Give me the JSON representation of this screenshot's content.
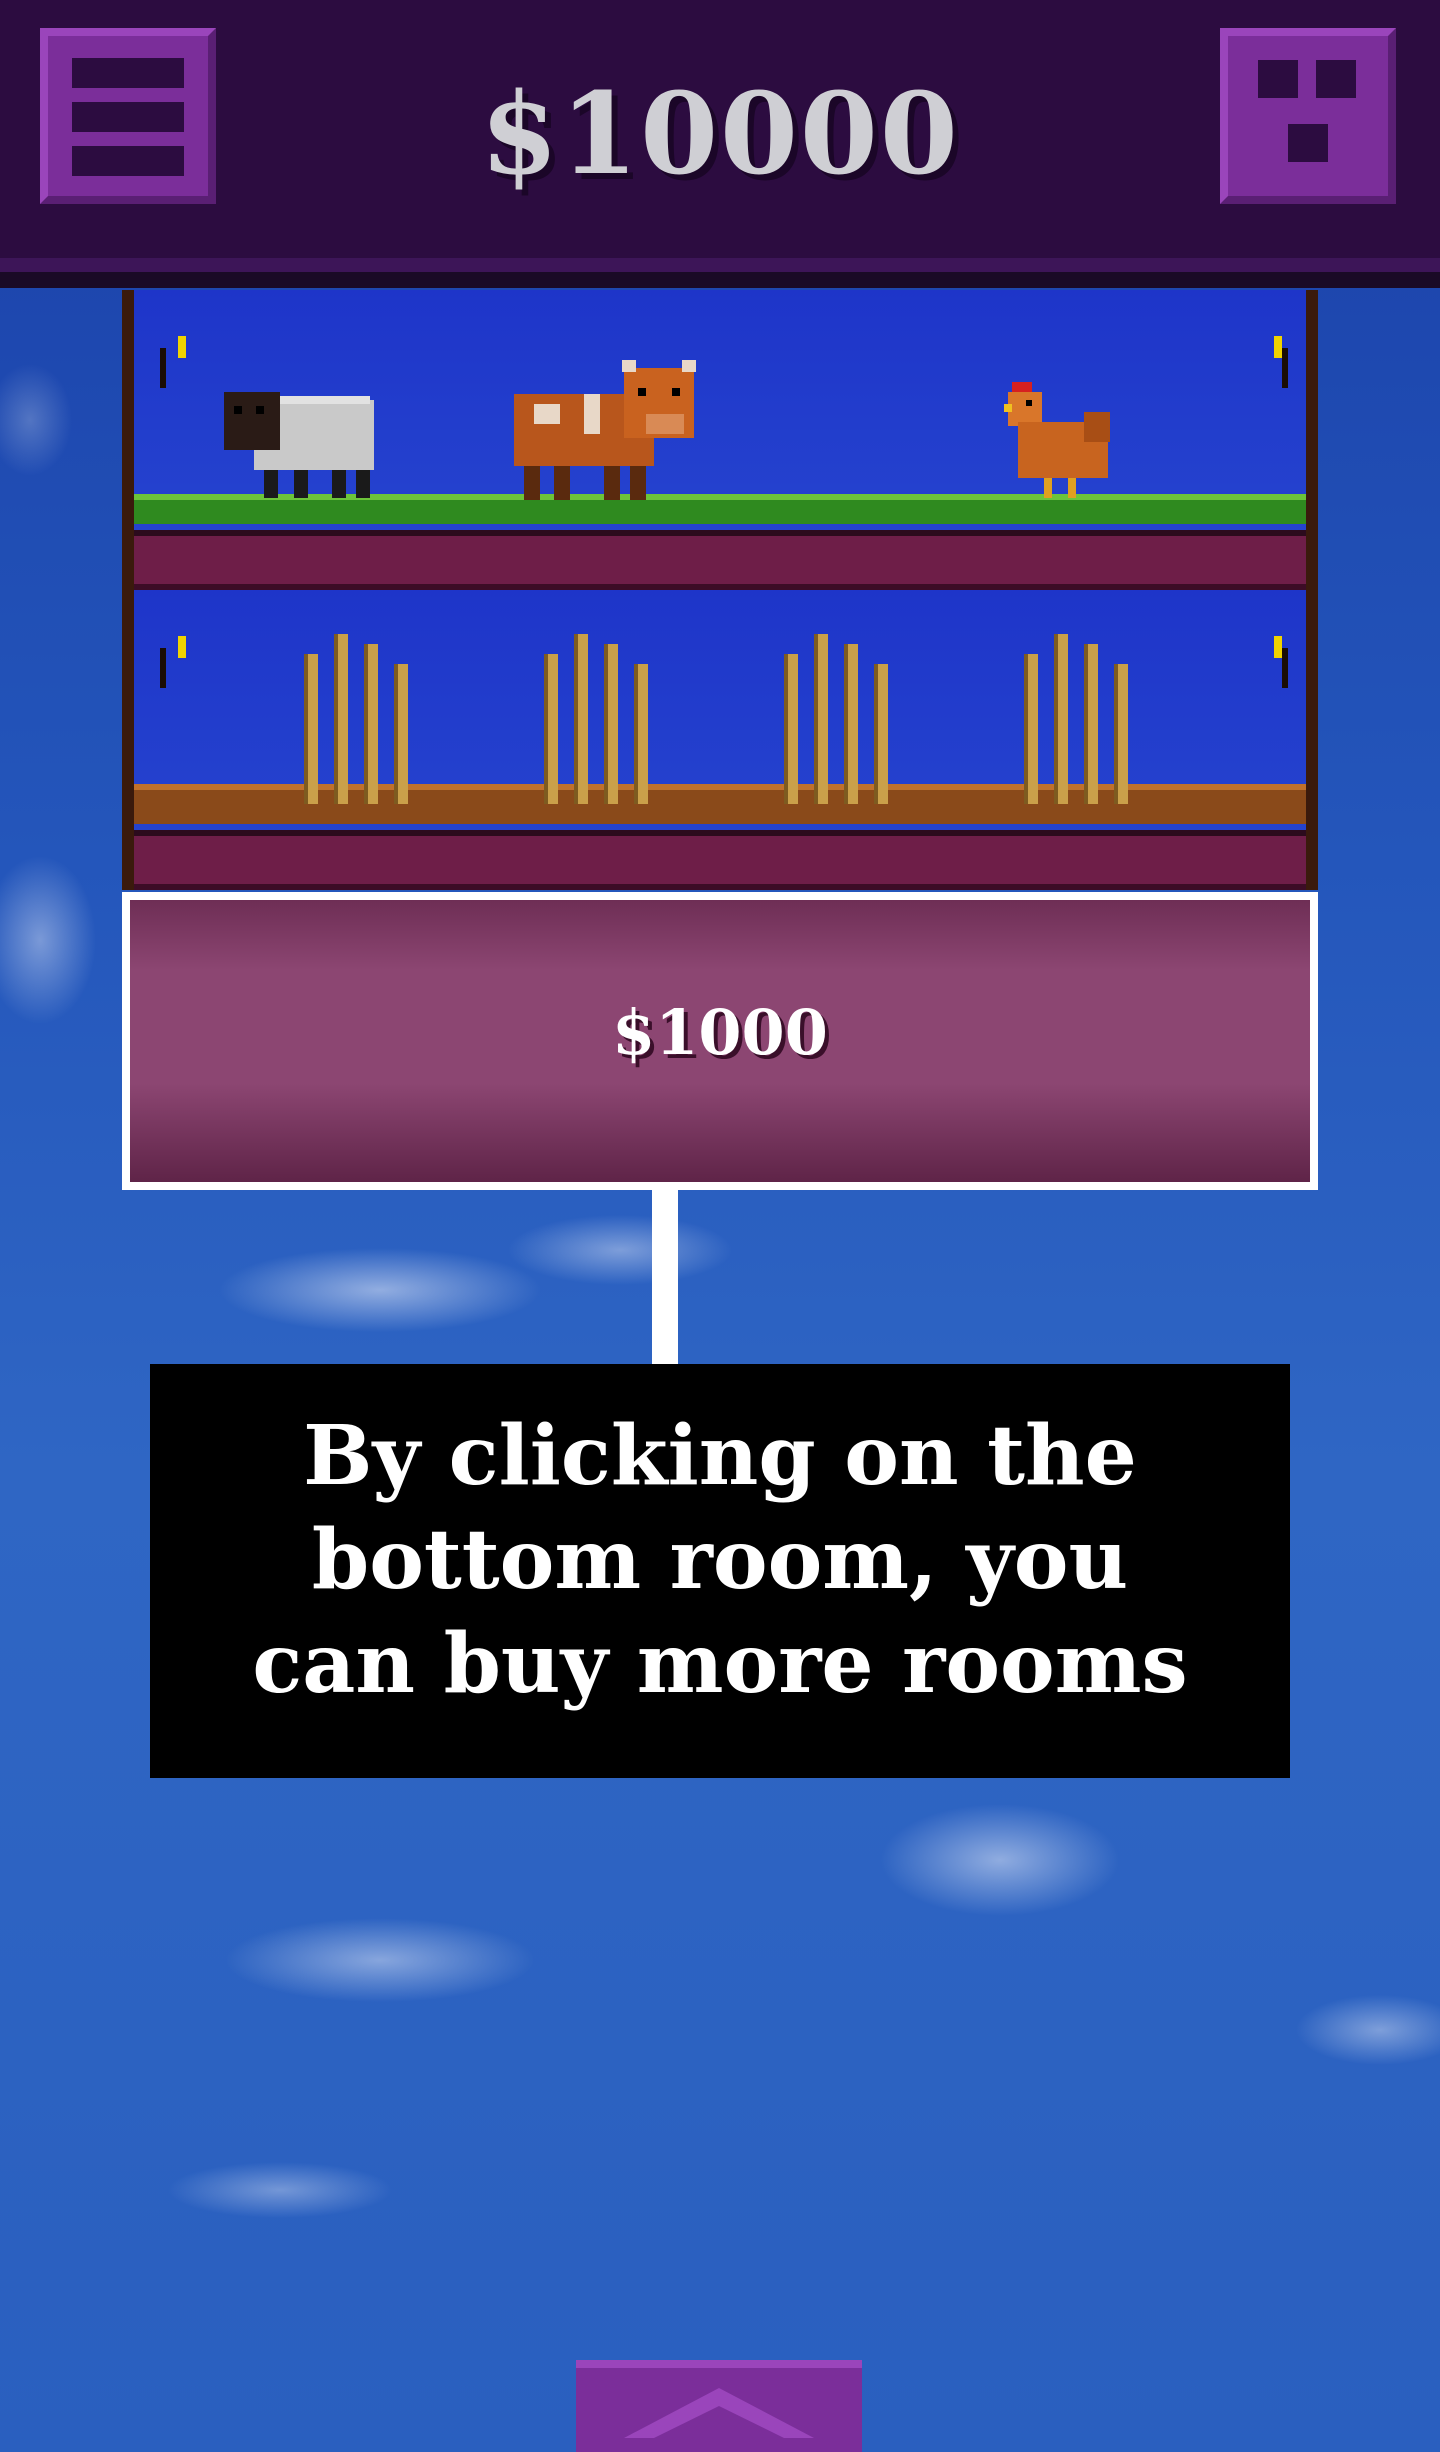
{
  "header": {
    "money": "$10000",
    "menu_icon": "menu-icon",
    "rooms_icon": "rooms-grid-icon"
  },
  "rooms": [
    {
      "type": "animals",
      "animals": [
        "sheep",
        "cow",
        "chicken"
      ]
    },
    {
      "type": "crops",
      "crops": [
        "corn",
        "corn",
        "corn",
        "corn"
      ]
    }
  ],
  "buy_room": {
    "price": "$1000"
  },
  "tutorial": {
    "line1": "By clicking on the",
    "line2": "bottom room, you",
    "line3": "can buy more rooms"
  },
  "footer": {
    "up_icon": "chevron-up-icon"
  },
  "colors": {
    "header_bg": "#2c0c40",
    "button_purple": "#7b2e9a",
    "buy_room_pink": "#8c4672",
    "tooltip_bg": "#000000"
  }
}
